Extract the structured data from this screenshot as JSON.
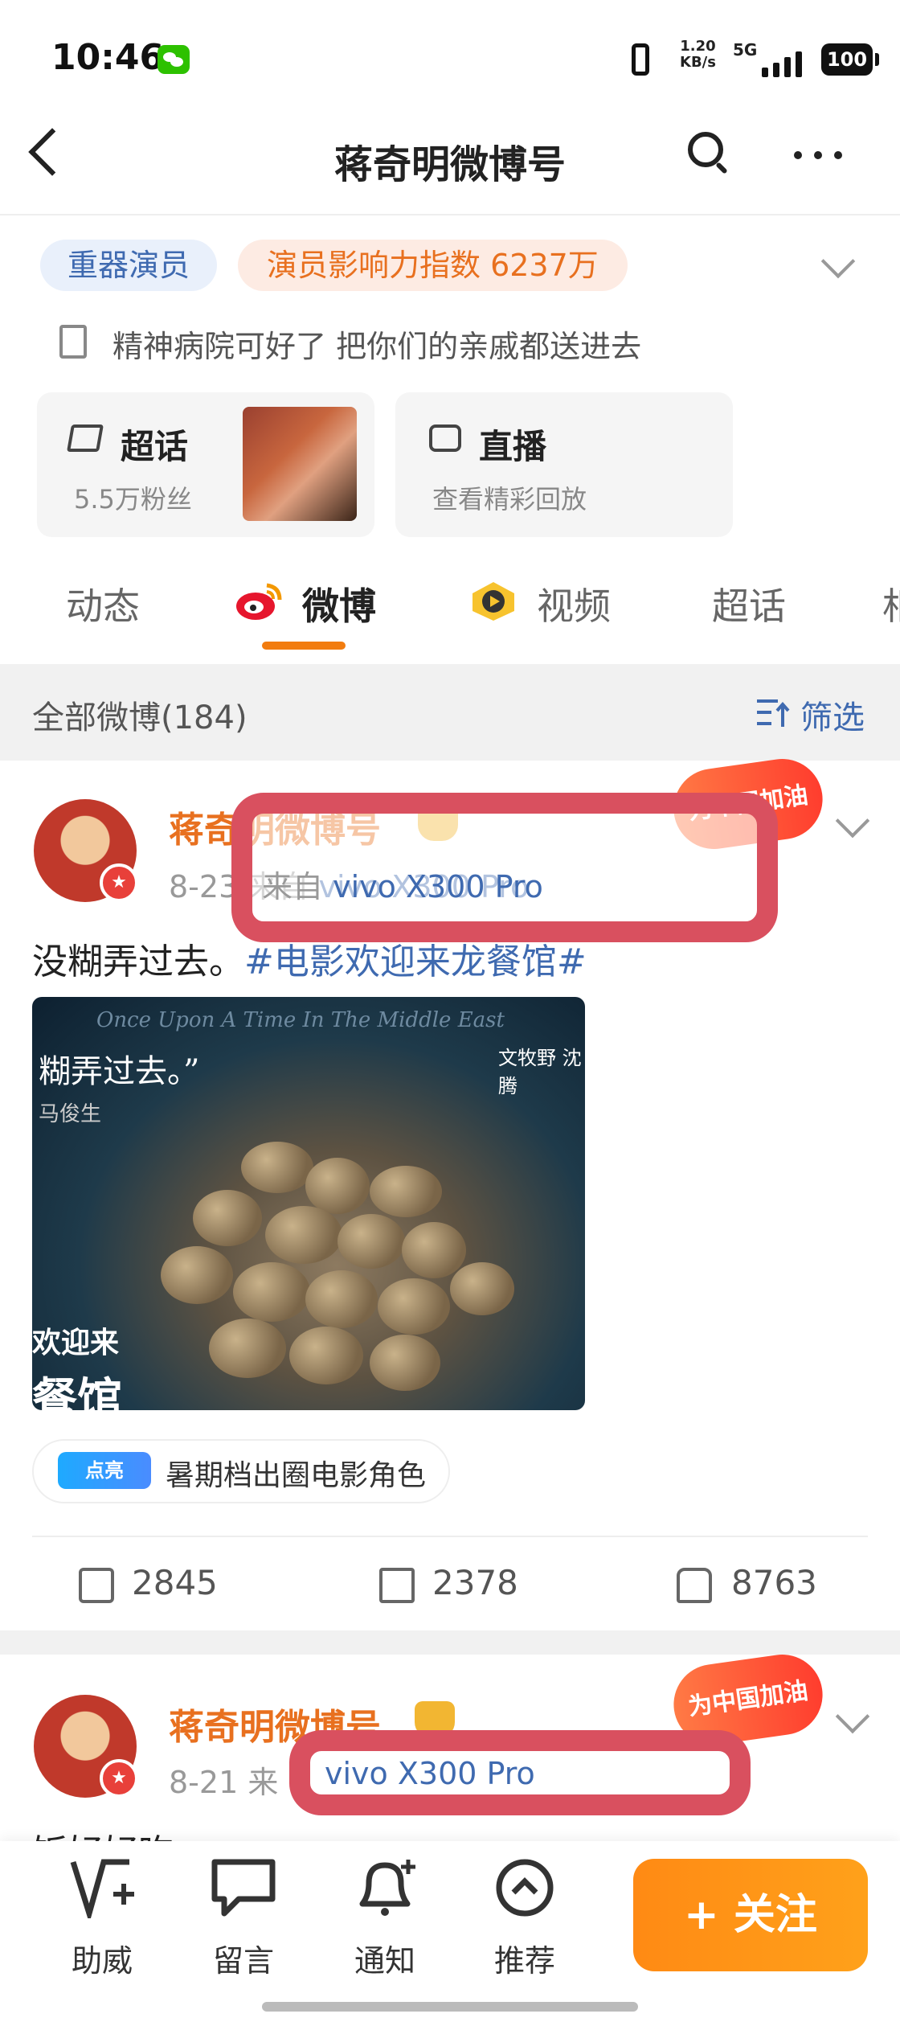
{
  "status_bar": {
    "time": "10:46",
    "net_speed": "1.20",
    "net_unit": "KB/s",
    "network": "5G",
    "battery": "100"
  },
  "header": {
    "title": "蒋奇明微博号"
  },
  "profile": {
    "badge_role": "重器演员",
    "badge_index": "演员影响力指数 6237万",
    "bio": "精神病院可好了 把你们的亲戚都送进去",
    "supertopic": {
      "title": "超话",
      "sub": "5.5万粉丝"
    },
    "live": {
      "title": "直播",
      "sub": "查看精彩回放"
    }
  },
  "tabs": [
    {
      "label": "动态"
    },
    {
      "label": "微博"
    },
    {
      "label": "视频"
    },
    {
      "label": "超话"
    },
    {
      "label": "相"
    }
  ],
  "filter": {
    "label": "全部微博(184)",
    "button": "筛选"
  },
  "posts": [
    {
      "author": "蒋奇明微博号",
      "date": "8-23",
      "from_label": "来自",
      "device": "vivo X300 Pro",
      "event_badge": "为中国加油",
      "text": "没糊弄过去。",
      "hashtag": "#电影欢迎来龙餐馆#",
      "image": {
        "top_text": "Once Upon A Time In The Middle East",
        "quote": "糊弄过去。”",
        "quote_author": "马俊生",
        "title": "欢迎来",
        "title2": "餐馆",
        "names": "文牧野 沈腾"
      },
      "tag_badge": "点亮",
      "tag_text": "暑期档出圈电影角色",
      "reposts": "2845",
      "comments": "2378",
      "likes": "8763"
    },
    {
      "author": "蒋奇明微博号",
      "date": "8-21",
      "from_label": "来",
      "device": "vivo X300 Pro",
      "event_badge": "为中国加油",
      "text": "饭好好吃"
    }
  ],
  "bottom_bar": {
    "items": [
      {
        "label": "助威"
      },
      {
        "label": "留言"
      },
      {
        "label": "通知"
      },
      {
        "label": "推荐"
      }
    ],
    "follow": "+ 关注"
  },
  "colors": {
    "accent": "#f27c0f",
    "link": "#3f6ab0",
    "highlight_box": "#d9505f"
  }
}
